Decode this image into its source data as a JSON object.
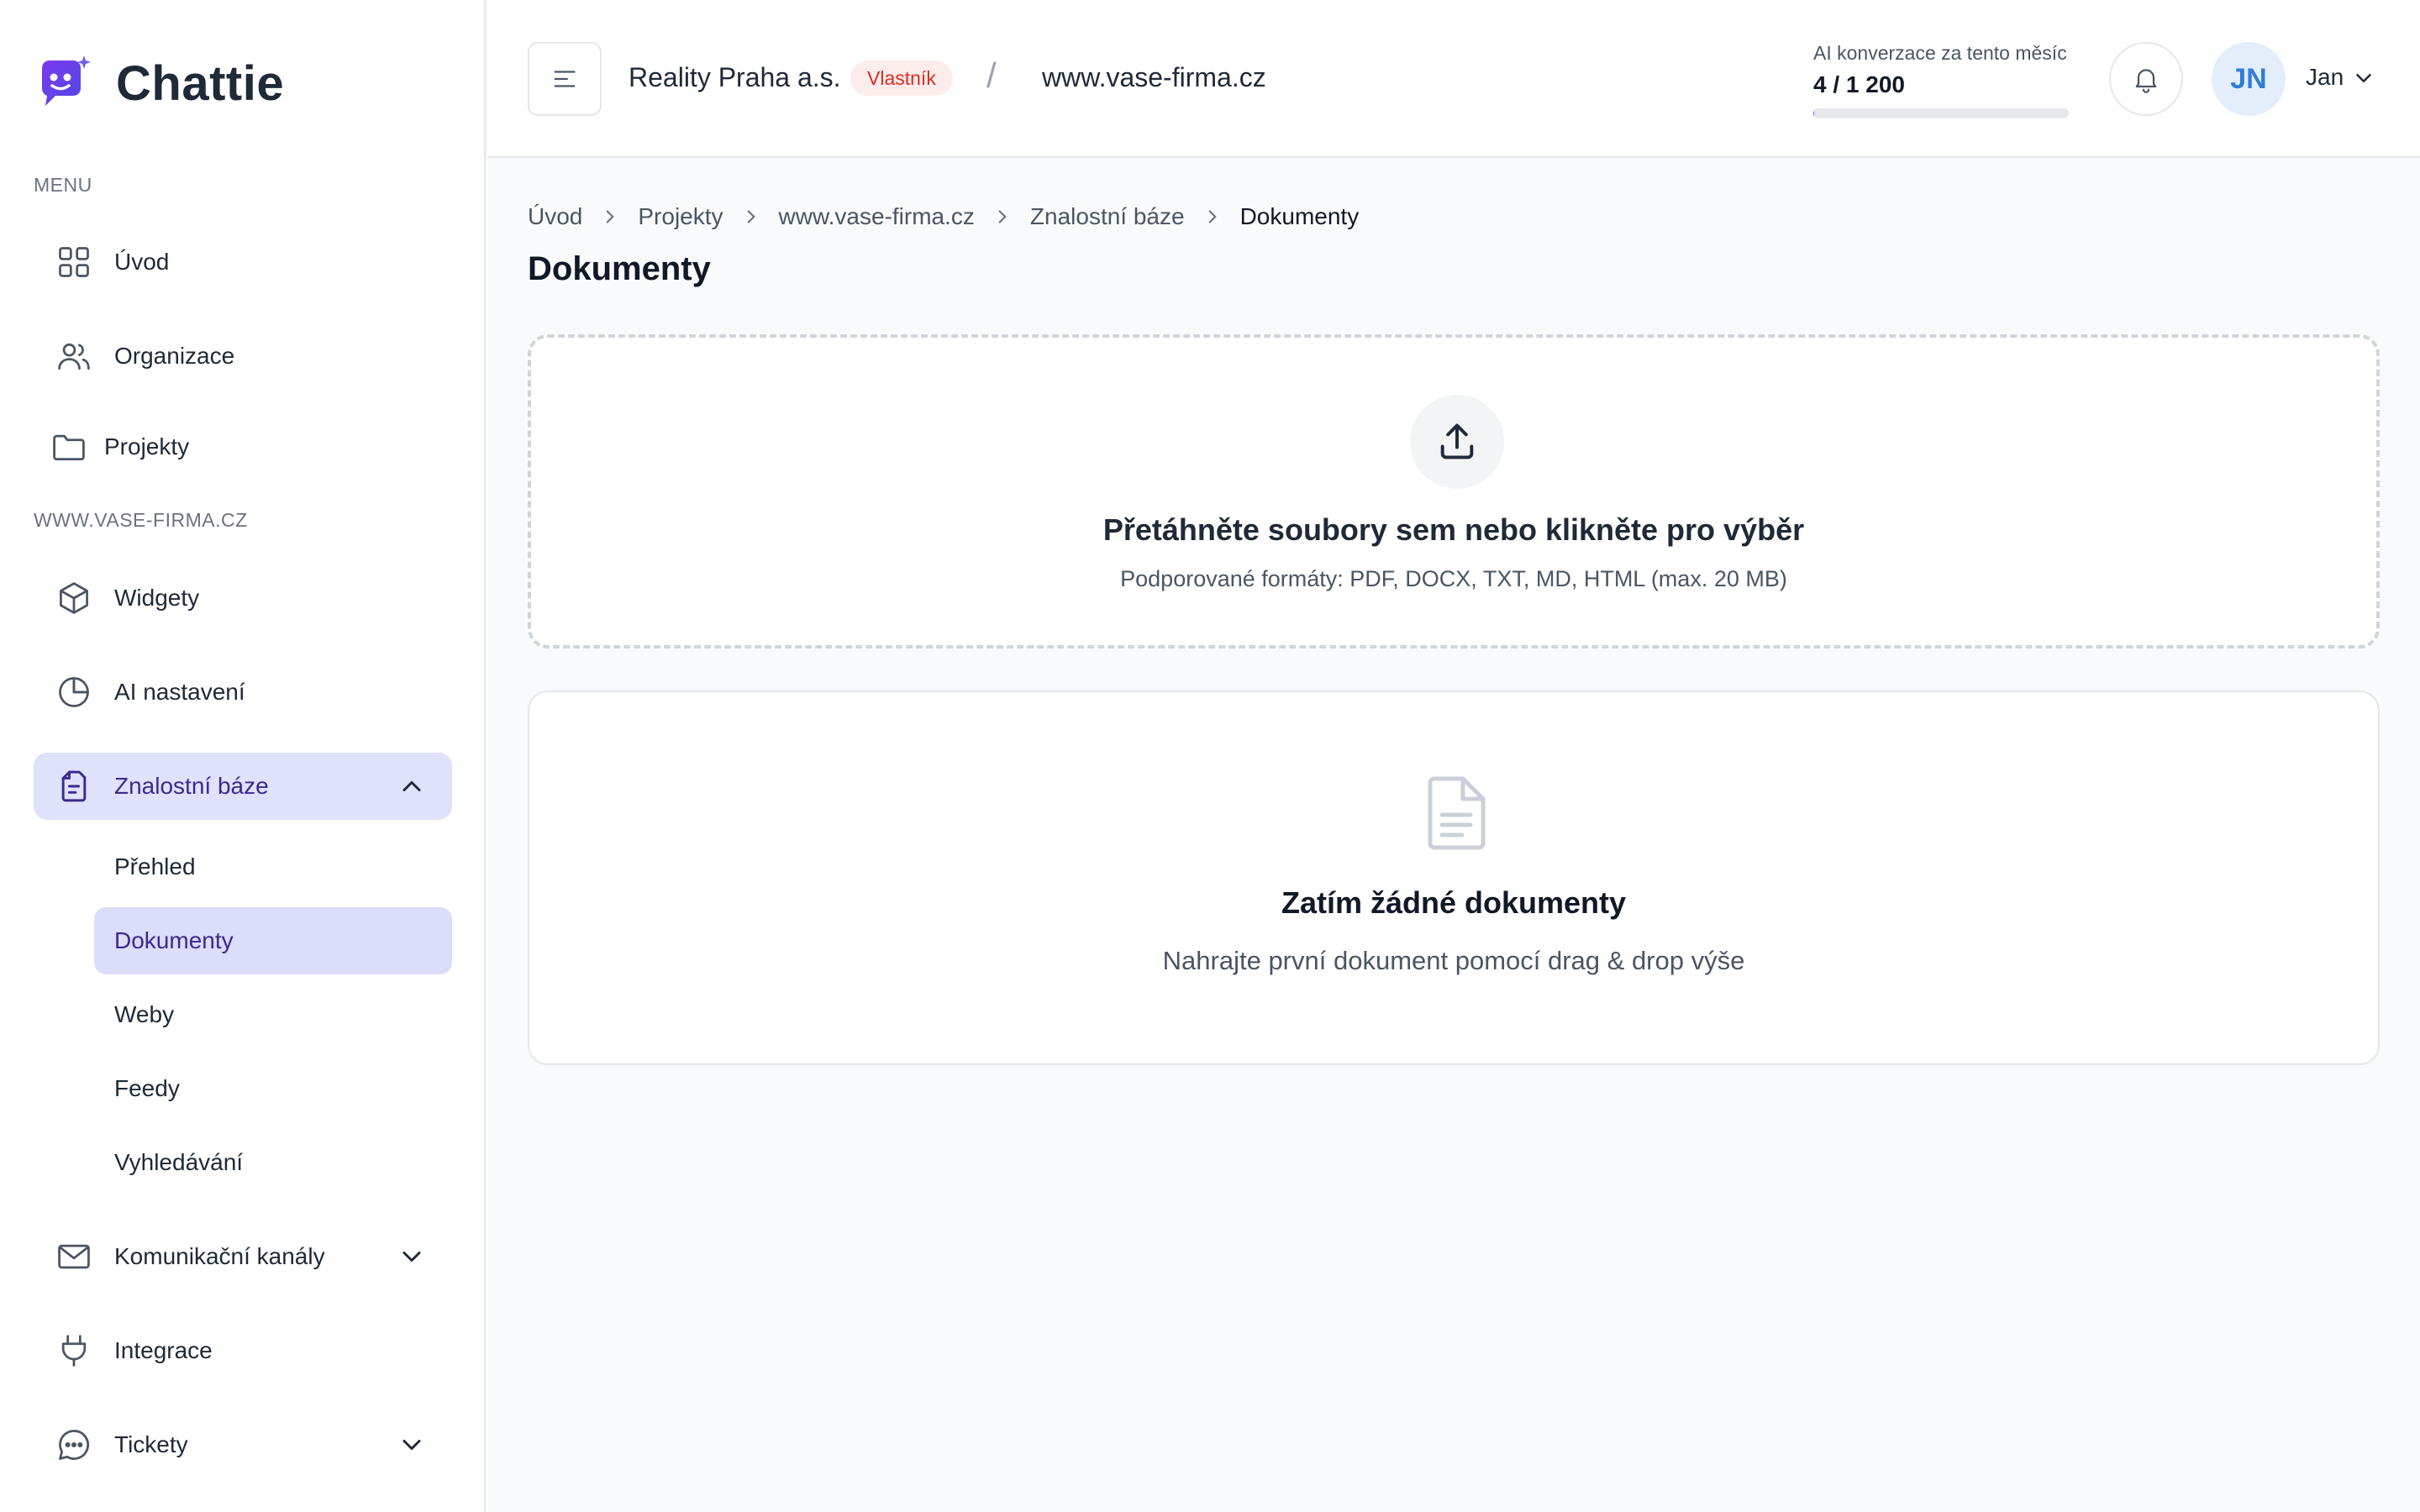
{
  "app": {
    "name": "Chattie"
  },
  "sidebar": {
    "menu_label": "MENU",
    "project_label": "WWW.VASE-FIRMA.CZ",
    "items": {
      "home": "Úvod",
      "organization": "Organizace",
      "projects": "Projekty",
      "widgets": "Widgety",
      "ai_settings": "AI nastavení",
      "knowledge_base": "Znalostní báze",
      "channels": "Komunikační kanály",
      "integrations": "Integrace",
      "tickets": "Tickety"
    },
    "knowledge_sub": {
      "overview": "Přehled",
      "documents": "Dokumenty",
      "webs": "Weby",
      "feeds": "Feedy",
      "search": "Vyhledávání"
    },
    "active": "Dokumenty"
  },
  "header": {
    "org_name": "Reality Praha a.s.",
    "role_badge": "Vlastník",
    "separator": "/",
    "domain": "www.vase-firma.cz",
    "usage_label": "AI konverzace za tento měsíc",
    "usage_value": "4 / 1 200",
    "usage_fraction": 0.0033,
    "user_initials": "JN",
    "user_name": "Jan"
  },
  "breadcrumb": [
    "Úvod",
    "Projekty",
    "www.vase-firma.cz",
    "Znalostní báze",
    "Dokumenty"
  ],
  "page": {
    "title": "Dokumenty",
    "dropzone_title": "Přetáhněte soubory sem nebo klikněte pro výběr",
    "dropzone_sub": "Podporované formáty: PDF, DOCX, TXT, MD, HTML (max. 20 MB)",
    "empty_title": "Zatím žádné dokumenty",
    "empty_sub": "Nahrajte první dokument pomocí drag & drop výše"
  },
  "colors": {
    "accent": "#6366f1",
    "active_bg": "#e0e1fb",
    "active_text": "#3b2a8f",
    "badge_bg": "#fdecec",
    "badge_text": "#d92d20",
    "avatar_bg": "#e3eefa",
    "avatar_text": "#2f7fd3"
  }
}
